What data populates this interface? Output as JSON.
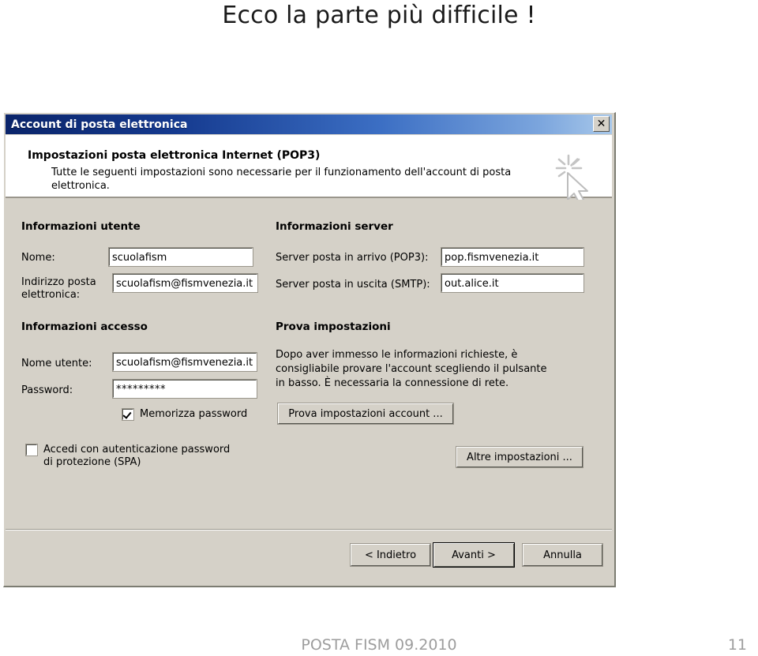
{
  "slide": {
    "heading": "Ecco la parte più difficile !",
    "footer_text": "POSTA FISM 09.2010",
    "page_number": "11"
  },
  "dialog": {
    "titlebar": {
      "title": "Account di posta elettronica",
      "close_label": "✕",
      "close_icon": "close-icon"
    },
    "header": {
      "title": "Impostazioni posta elettronica Internet (POP3)",
      "subtitle": "Tutte le seguenti impostazioni sono necessarie per il funzionamento dell'account di posta elettronica.",
      "icon": "cursor-sparkle-icon"
    },
    "user_info": {
      "section_title": "Informazioni utente",
      "name_label": "Nome:",
      "name_value": "scuolafism",
      "email_label_line1": "Indirizzo posta",
      "email_label_line2": "elettronica:",
      "email_value": "scuolafism@fismvenezia.it"
    },
    "server_info": {
      "section_title": "Informazioni server",
      "incoming_label": "Server posta in arrivo (POP3):",
      "incoming_value": "pop.fismvenezia.it",
      "outgoing_label": "Server posta in uscita (SMTP):",
      "outgoing_value": "out.alice.it"
    },
    "logon_info": {
      "section_title": "Informazioni accesso",
      "username_label": "Nome utente:",
      "username_value": "scuolafism@fismvenezia.it",
      "password_label": "Password:",
      "password_value": "*********",
      "remember_password_label": "Memorizza password",
      "remember_password_checked": true,
      "spa_label_line1": "Accedi con autenticazione password",
      "spa_label_line2": "di protezione (SPA)",
      "spa_checked": false
    },
    "test_settings": {
      "section_title": "Prova impostazioni",
      "description": "Dopo aver immesso le informazioni richieste, è consigliabile provare l'account scegliendo il pulsante in basso. È necessaria la connessione di rete.",
      "test_button_label": "Prova impostazioni account ...",
      "more_settings_button_label": "Altre impostazioni ..."
    },
    "footer_buttons": {
      "back_label": "< Indietro",
      "next_label": "Avanti >",
      "cancel_label": "Annulla"
    }
  },
  "colors": {
    "titlebar_start": "#0a246a",
    "titlebar_end": "#a8c8ea",
    "dialog_face": "#d5d1c8",
    "text": "#000000",
    "footer_gray": "#9d9d9d"
  }
}
